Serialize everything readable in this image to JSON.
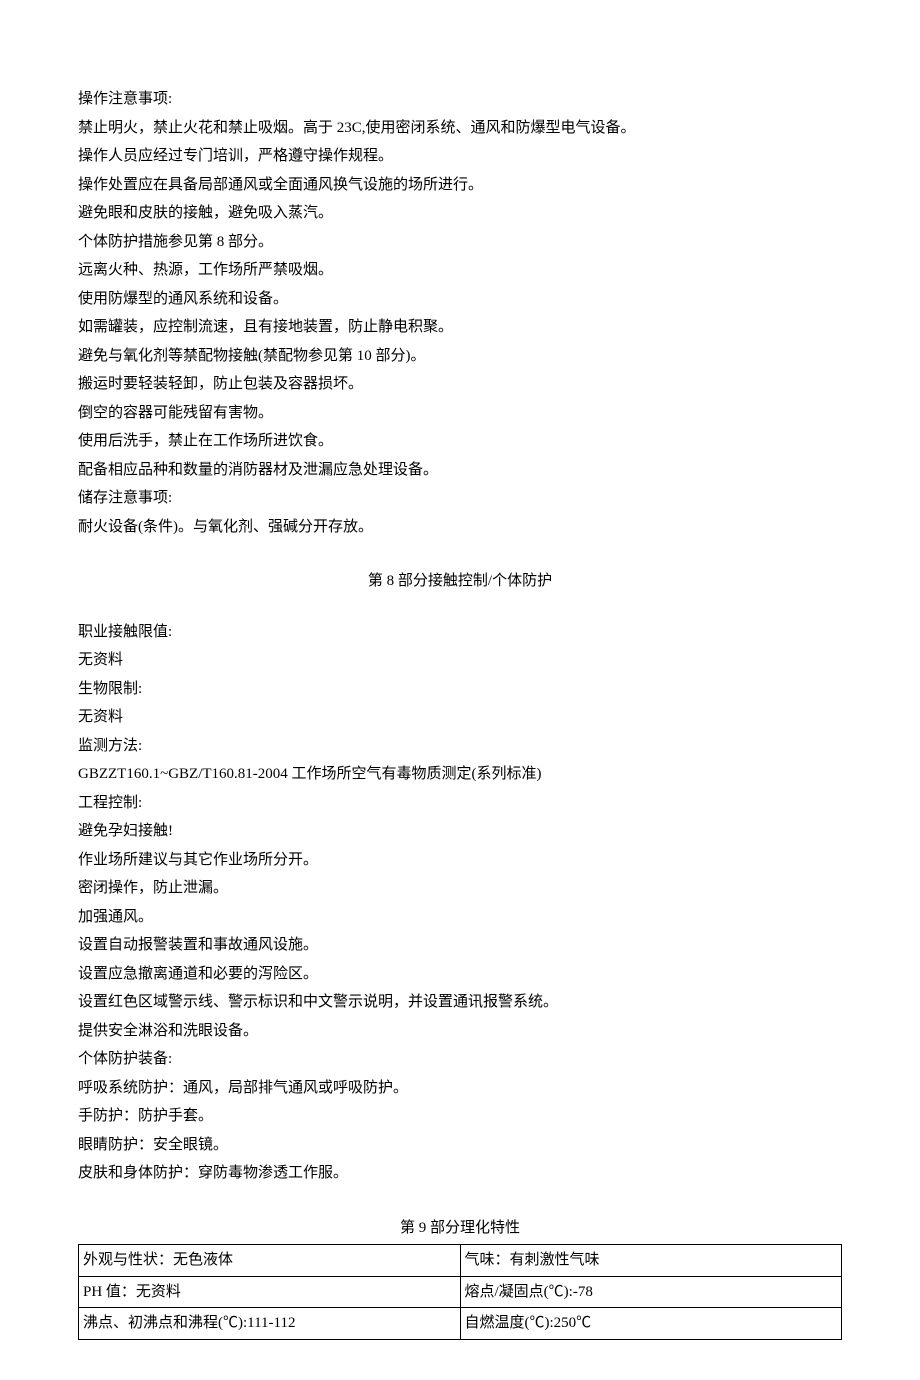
{
  "sec7": {
    "lines": [
      "操作注意事项:",
      "禁止明火，禁止火花和禁止吸烟。高于 23C,使用密闭系统、通风和防爆型电气设备。",
      "操作人员应经过专门培训，严格遵守操作规程。",
      "操作处置应在具备局部通风或全面通风换气设施的场所进行。",
      "避免眼和皮肤的接触，避免吸入蒸汽。",
      "个体防护措施参见第 8 部分。",
      "远离火种、热源，工作场所严禁吸烟。",
      "使用防爆型的通风系统和设备。",
      "如需罐装，应控制流速，且有接地装置，防止静电积聚。",
      "避免与氧化剂等禁配物接触(禁配物参见第 10 部分)。",
      "搬运时要轻装轻卸，防止包装及容器损坏。",
      "倒空的容器可能残留有害物。",
      "使用后洗手，禁止在工作场所进饮食。",
      "配备相应品种和数量的消防器材及泄漏应急处理设备。",
      "储存注意事项:",
      "耐火设备(条件)。与氧化剂、强碱分开存放。"
    ]
  },
  "sec8": {
    "title": "第 8 部分接触控制/个体防护",
    "lines": [
      "职业接触限值:",
      "无资料",
      "生物限制:",
      "无资料",
      "监测方法:",
      "GBZZT160.1~GBZ/T160.81-2004 工作场所空气有毒物质测定(系列标准)",
      "工程控制:",
      "避免孕妇接触!",
      "作业场所建议与其它作业场所分开。",
      "密闭操作，防止泄漏。",
      "加强通风。",
      "设置自动报警装置和事故通风设施。",
      "设置应急撤离通道和必要的泻险区。",
      "设置红色区域警示线、警示标识和中文警示说明，并设置通讯报警系统。",
      "提供安全淋浴和洗眼设备。",
      "个体防护装备:",
      "呼吸系统防护：通风，局部排气通风或呼吸防护。",
      "手防护：防护手套。",
      "眼睛防护：安全眼镜。",
      "皮肤和身体防护：穿防毒物渗透工作服。"
    ]
  },
  "sec9": {
    "title": "第 9 部分理化特性",
    "table": [
      [
        "外观与性状：无色液体",
        "气味：有刺激性气味"
      ],
      [
        "PH 值：无资料",
        "熔点/凝固点(℃):-78"
      ],
      [
        "沸点、初沸点和沸程(℃):111-112",
        "自燃温度(℃):250℃"
      ]
    ]
  }
}
